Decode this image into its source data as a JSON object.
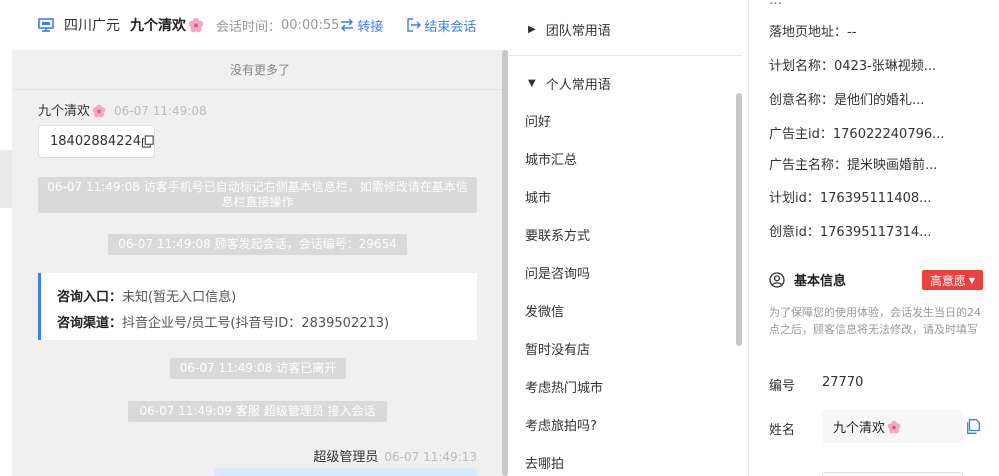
{
  "chat": {
    "header": {
      "region": "四川广元",
      "customer_name": "九个清欢",
      "time_label": "会话时间：",
      "time_value": "00:00:55",
      "transfer_label": "转接",
      "end_label": "结束会话"
    },
    "no_more_text": "没有更多了",
    "customer_msg": {
      "sender": "九个清欢",
      "time": "06-07 11:49:08",
      "text": "18402884224"
    },
    "system_messages": [
      "06-07 11:49:08 访客手机号已自动标记右侧基本信息栏，如需修改请在基本信息栏直接操作",
      "06-07 11:49:08 顾客发起会话，会话编号：29654",
      "06-07 11:49:08 访客已离开",
      "06-07 11:49:09 客服 超级管理员 接入会话"
    ],
    "inquiry_card": {
      "entry_label": "咨询入口：",
      "entry_value": "未知(暂无入口信息)",
      "channel_label": "咨询渠道：",
      "channel_value": "抖音企业号/员工号(抖音号ID：2839502213)"
    },
    "agent_msg": {
      "sender": "超级管理员",
      "time": "06-07 11:49:13"
    }
  },
  "phrases": {
    "team_group": "团队常用语",
    "personal_group": "个人常用语",
    "items": [
      "问好",
      "城市汇总",
      "城市",
      "要联系方式",
      "问是咨询吗",
      "发微信",
      "暂时没有店",
      "考虑热门城市",
      "考虑旅拍吗?",
      "去哪拍"
    ]
  },
  "info": {
    "fields": [
      {
        "label": "落地页地址：",
        "value": "--"
      },
      {
        "label": "计划名称：",
        "value": "0423-张琳视频..."
      },
      {
        "label": "创意名称：",
        "value": "是他们的婚礼..."
      },
      {
        "label": "广告主id：",
        "value": "176022240796..."
      },
      {
        "label": "广告主名称：",
        "value": "提米映画婚前..."
      },
      {
        "label": "计划id：",
        "value": "176395111408..."
      },
      {
        "label": "创意id：",
        "value": "176395117314..."
      }
    ],
    "basic_title": "基本信息",
    "intent_badge": "高意愿",
    "notice": "为了保障您的使用体验，会话发生当日的24点之后，顾客信息将无法修改，请及时填写",
    "number_label": "编号",
    "number_value": "27770",
    "name_label": "姓名",
    "name_value": "九个清欢"
  },
  "colors": {
    "accent": "#3a7ff0",
    "badge": "#e8413e",
    "system_msg_bg": "#d9d9d9",
    "chat_bg": "#f0f0f0"
  }
}
